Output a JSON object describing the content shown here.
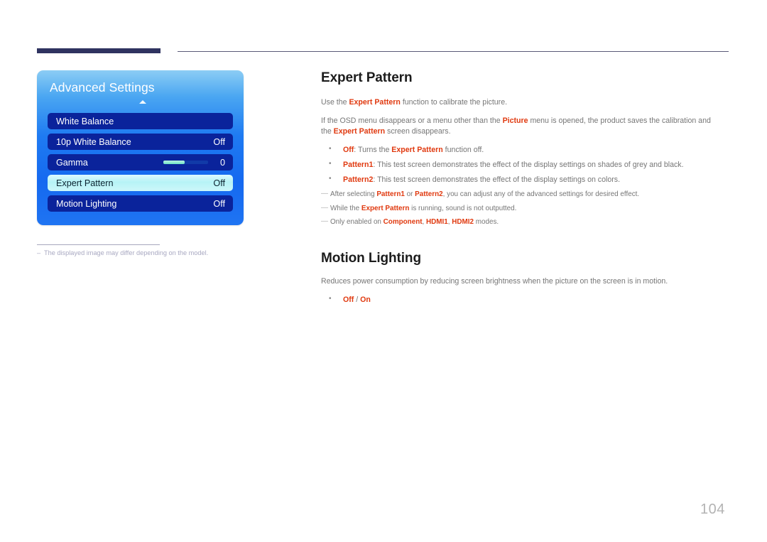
{
  "page": {
    "number": "104"
  },
  "osd": {
    "title": "Advanced Settings",
    "collapse_arrow": "up-arrow-icon",
    "rows": [
      {
        "label": "White Balance",
        "value": ""
      },
      {
        "label": "10p White Balance",
        "value": "Off"
      },
      {
        "label": "Gamma",
        "value": "0",
        "slider_percent": 47
      },
      {
        "label": "Expert Pattern",
        "value": "Off",
        "selected": true
      },
      {
        "label": "Motion Lighting",
        "value": "Off"
      }
    ],
    "footnote": {
      "dash": "–",
      "text": "The displayed image may differ depending on the model."
    }
  },
  "content": {
    "sections": [
      {
        "title": "Expert Pattern",
        "paragraphs": [
          {
            "parts": [
              {
                "t": "Use the ",
                "style": "plain"
              },
              {
                "t": "Expert Pattern",
                "style": "kw"
              },
              {
                "t": " function to calibrate the picture.",
                "style": "plain"
              }
            ]
          },
          {
            "parts": [
              {
                "t": "If the OSD menu disappears or a menu other than the ",
                "style": "plain"
              },
              {
                "t": "Picture",
                "style": "kw"
              },
              {
                "t": " menu is opened, the product saves the calibration and the ",
                "style": "plain"
              },
              {
                "t": "Expert Pattern",
                "style": "kw"
              },
              {
                "t": " screen disappears.",
                "style": "plain"
              }
            ]
          }
        ],
        "bullets": [
          {
            "parts": [
              {
                "t": "Off",
                "style": "kw"
              },
              {
                "t": ": Turns the ",
                "style": "plain"
              },
              {
                "t": "Expert Pattern",
                "style": "kw"
              },
              {
                "t": " function off.",
                "style": "plain"
              }
            ]
          },
          {
            "parts": [
              {
                "t": "Pattern1",
                "style": "kw"
              },
              {
                "t": ": This test screen demonstrates the effect of the display settings on shades of grey and black.",
                "style": "plain"
              }
            ]
          },
          {
            "parts": [
              {
                "t": "Pattern2",
                "style": "kw"
              },
              {
                "t": ": This test screen demonstrates the effect of the display settings on colors.",
                "style": "plain"
              }
            ]
          }
        ],
        "notes": [
          {
            "dash": "—",
            "parts": [
              {
                "t": "After selecting ",
                "style": "plain"
              },
              {
                "t": "Pattern1",
                "style": "kw"
              },
              {
                "t": " or ",
                "style": "plain"
              },
              {
                "t": "Pattern2",
                "style": "kw"
              },
              {
                "t": ", you can adjust any of the advanced settings for desired effect.",
                "style": "plain"
              }
            ]
          },
          {
            "dash": "—",
            "parts": [
              {
                "t": "While the ",
                "style": "plain"
              },
              {
                "t": "Expert Pattern",
                "style": "kw"
              },
              {
                "t": " is running, sound is not outputted.",
                "style": "plain"
              }
            ]
          },
          {
            "dash": "—",
            "parts": [
              {
                "t": "Only enabled on ",
                "style": "plain"
              },
              {
                "t": "Component",
                "style": "kw"
              },
              {
                "t": ", ",
                "style": "plain"
              },
              {
                "t": "HDMI1",
                "style": "kw"
              },
              {
                "t": ", ",
                "style": "plain"
              },
              {
                "t": "HDMI2",
                "style": "kw"
              },
              {
                "t": " modes.",
                "style": "plain"
              }
            ]
          }
        ]
      },
      {
        "title": "Motion Lighting",
        "paragraphs": [
          {
            "parts": [
              {
                "t": "Reduces power consumption by reducing screen brightness when the picture on the screen is in motion.",
                "style": "plain"
              }
            ]
          }
        ],
        "bullets": [
          {
            "parts": [
              {
                "t": "Off",
                "style": "kw"
              },
              {
                "t": " / ",
                "style": "plain"
              },
              {
                "t": "On",
                "style": "kw"
              }
            ]
          }
        ],
        "notes": []
      }
    ]
  },
  "colors": {
    "accent_red": "#e0390f",
    "body_text": "#767676",
    "heading": "#1c1c1c",
    "osd_blue_top": "#8ccdf4",
    "osd_blue_bottom": "#1f74f2",
    "osd_row": "#0a239b",
    "osd_row_selected": "#b6f3f6",
    "rule_navy": "#2f3360",
    "page_number": "#b3b3b3"
  }
}
